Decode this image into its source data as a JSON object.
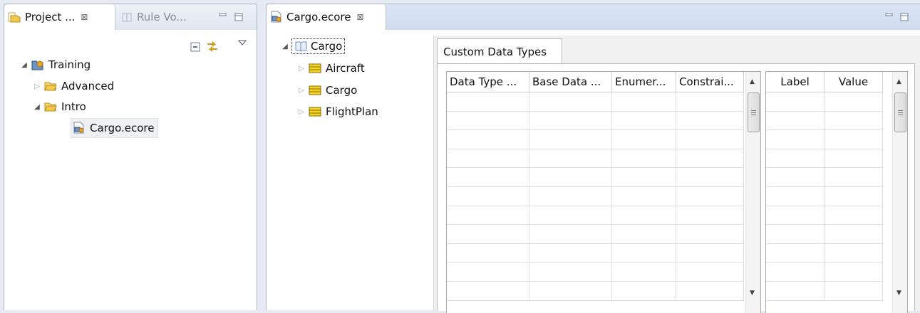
{
  "left_view": {
    "tabs": [
      {
        "label": "Project ...",
        "close": "⊠",
        "icon": "project-explorer-icon"
      },
      {
        "label": "Rule Vo...",
        "icon": "rule-vocabulary-icon"
      }
    ],
    "tree": [
      {
        "label": "Training",
        "icon": "project-icon"
      },
      {
        "label": "Advanced",
        "icon": "folder-icon"
      },
      {
        "label": "Intro",
        "icon": "folder-icon"
      },
      {
        "label": "Cargo.ecore",
        "icon": "ecore-file-icon"
      }
    ]
  },
  "editor": {
    "tab_label": "Cargo.ecore",
    "tab_close": "⊠",
    "tree": {
      "root": "Cargo",
      "children": [
        "Aircraft",
        "Cargo",
        "FlightPlan"
      ]
    },
    "details": {
      "tab": "Custom Data Types",
      "main_table": {
        "columns": [
          "Data Type ...",
          "Base Data ...",
          "Enumer...",
          "Constrai..."
        ],
        "row_count": 11
      },
      "enum_table": {
        "columns": [
          "Label",
          "Value"
        ],
        "row_count": 11
      }
    }
  },
  "colors": {
    "folder": "#f3c94c",
    "class_icon": "#f5d327",
    "package_icon": "#6f93c6"
  }
}
